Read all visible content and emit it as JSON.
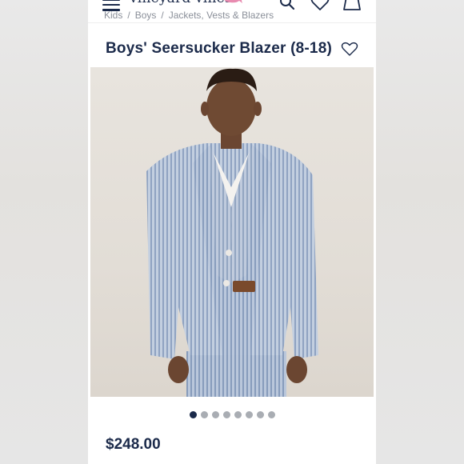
{
  "header": {
    "logo_text": "vineyard vines",
    "icons": [
      "menu-icon",
      "search-icon",
      "heart-icon",
      "bag-icon"
    ]
  },
  "breadcrumb": [
    "Kids",
    "Boys",
    "Jackets, Vests & Blazers"
  ],
  "product": {
    "title": "Boys' Seersucker Blazer (8-18)",
    "price": "$248.00"
  },
  "carousel": {
    "image_count": 8,
    "active_index": 0
  },
  "colors": {
    "brand_navy": "#1b2a4a",
    "dot_inactive": "#a9adb3",
    "logo_whale_pink": "#e88bb0"
  }
}
